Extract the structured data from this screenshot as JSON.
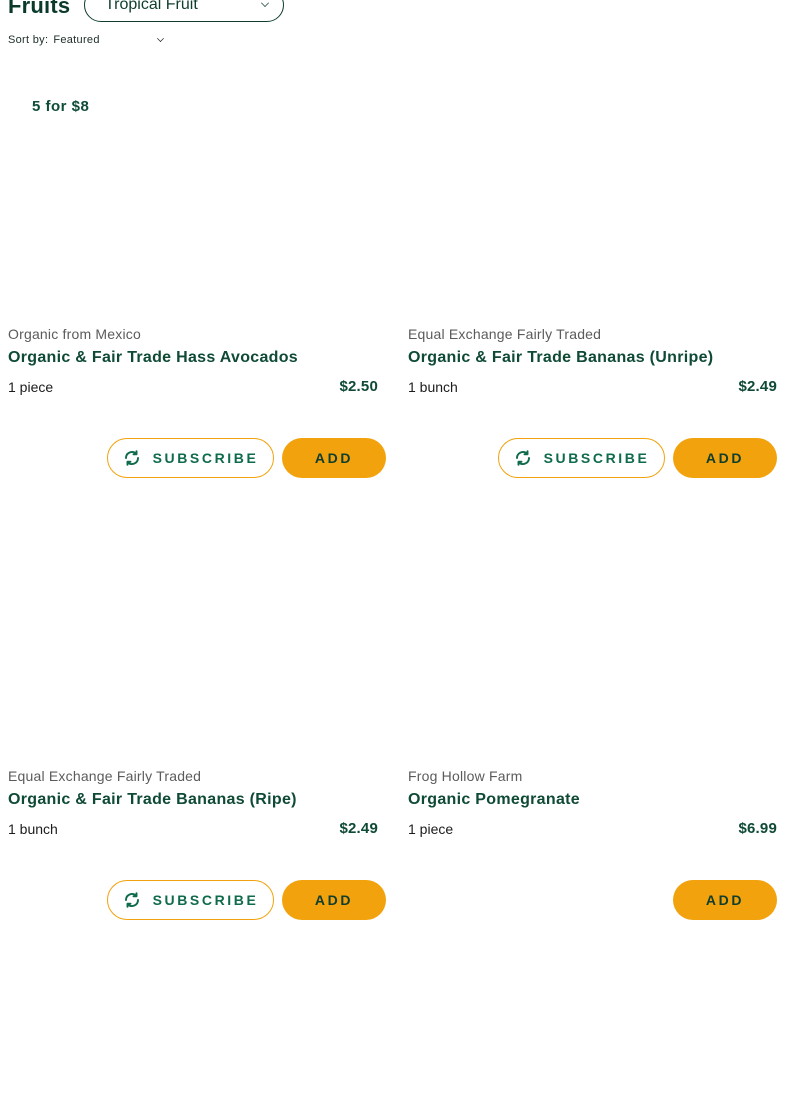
{
  "header": {
    "category_title": "Fruits",
    "subcategory_value": "Tropical Fruit",
    "sort_label": "Sort by:",
    "sort_value": "Featured"
  },
  "promo": "5 for $8",
  "buttons": {
    "subscribe": "SUBSCRIBE",
    "add": "ADD"
  },
  "products": [
    {
      "brand": "Organic from Mexico",
      "name": "Organic & Fair Trade Hass Avocados",
      "qty": "1 piece",
      "price": "$2.50",
      "subscribable": true
    },
    {
      "brand": "Equal Exchange Fairly Traded",
      "name": "Organic & Fair Trade Bananas (Unripe)",
      "qty": "1 bunch",
      "price": "$2.49",
      "subscribable": true
    },
    {
      "brand": "Equal Exchange Fairly Traded",
      "name": "Organic & Fair Trade Bananas (Ripe)",
      "qty": "1 bunch",
      "price": "$2.49",
      "subscribable": true
    },
    {
      "brand": "Frog Hollow Farm",
      "name": "Organic Pomegranate",
      "qty": "1 piece",
      "price": "$6.99",
      "subscribable": false
    }
  ],
  "colors": {
    "accent": "#f2a20c",
    "brand_green": "#0e4a34"
  }
}
